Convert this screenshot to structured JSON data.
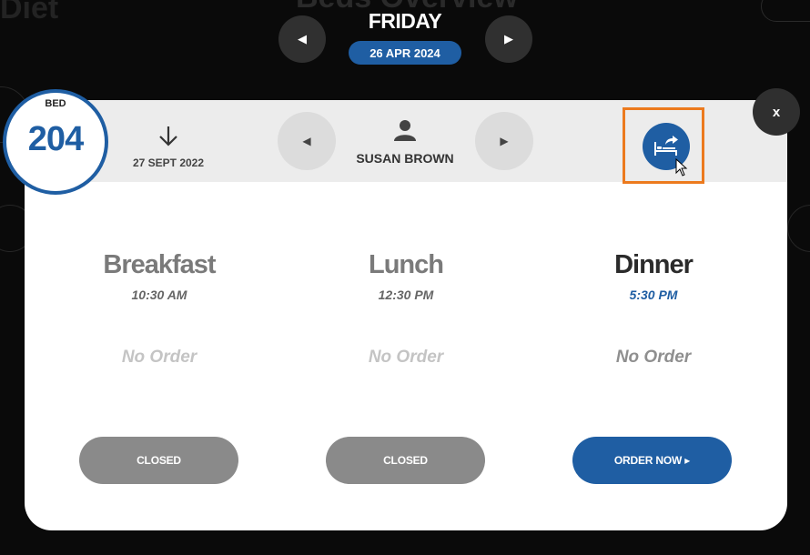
{
  "header": {
    "day": "FRIDAY",
    "date": "26 APR 2024",
    "prev_icon": "left-triangle-icon",
    "next_icon": "right-triangle-icon"
  },
  "modal": {
    "bed": {
      "label": "BED",
      "number": "204"
    },
    "admission": {
      "icon": "down-arrow-icon",
      "date": "27 SEPT 2022"
    },
    "patient": {
      "icon": "person-icon",
      "name": "SUSAN BROWN"
    },
    "move_bed_icon": "bed-transfer-icon",
    "close_label": "x",
    "meals": [
      {
        "name": "Breakfast",
        "time": "10:30 AM",
        "order": "No Order",
        "button": "CLOSED"
      },
      {
        "name": "Lunch",
        "time": "12:30 PM",
        "order": "No Order",
        "button": "CLOSED"
      },
      {
        "name": "Dinner",
        "time": "5:30 PM",
        "order": "No Order",
        "button": "ORDER NOW ▸"
      }
    ]
  },
  "colors": {
    "primary": "#1f5ea3",
    "highlight": "#ec7a1e",
    "closed": "#8a8a8a"
  }
}
